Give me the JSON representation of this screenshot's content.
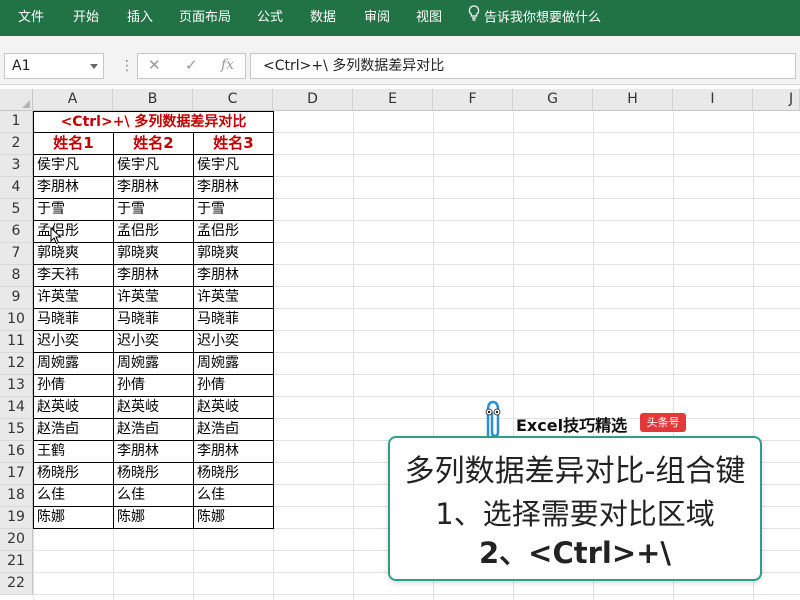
{
  "ribbon": {
    "tabs": [
      "文件",
      "开始",
      "插入",
      "页面布局",
      "公式",
      "数据",
      "审阅",
      "视图"
    ],
    "tell_me": "告诉我你想要做什么",
    "color": "#217346"
  },
  "formula_bar": {
    "name_box": "A1",
    "cancel_icon": "✕",
    "enter_icon": "✓",
    "fx_label": "fx",
    "formula": "<Ctrl>+\\ 多列数据差异对比"
  },
  "columns": [
    "A",
    "B",
    "C",
    "D",
    "E",
    "F",
    "G",
    "H",
    "I",
    "J"
  ],
  "rows": [
    "1",
    "2",
    "3",
    "4",
    "5",
    "6",
    "7",
    "8",
    "9",
    "10",
    "11",
    "12",
    "13",
    "14",
    "15",
    "16",
    "17",
    "18",
    "19",
    "20",
    "21",
    "22"
  ],
  "table": {
    "title": "<Ctrl>+\\ 多列数据差异对比",
    "headers": [
      "姓名1",
      "姓名2",
      "姓名3"
    ],
    "data": [
      [
        "侯宇凡",
        "侯宇凡",
        "侯宇凡"
      ],
      [
        "李朋林",
        "李朋林",
        "李朋林"
      ],
      [
        "于雪",
        "于雪",
        "于雪"
      ],
      [
        "孟侣彤",
        "孟侣彤",
        "孟侣彤"
      ],
      [
        "郭晓爽",
        "郭晓爽",
        "郭晓爽"
      ],
      [
        "李天祎",
        "李朋林",
        "李朋林"
      ],
      [
        "许英莹",
        "许英莹",
        "许英莹"
      ],
      [
        "马晓菲",
        "马晓菲",
        "马晓菲"
      ],
      [
        "迟小奕",
        "迟小奕",
        "迟小奕"
      ],
      [
        "周婉露",
        "周婉露",
        "周婉露"
      ],
      [
        "孙倩",
        "孙倩",
        "孙倩"
      ],
      [
        "赵英岐",
        "赵英岐",
        "赵英岐"
      ],
      [
        "赵浩卣",
        "赵浩卣",
        "赵浩卣"
      ],
      [
        "王鹤",
        "李朋林",
        "李朋林"
      ],
      [
        "杨晓彤",
        "杨晓彤",
        "杨晓彤"
      ],
      [
        "么佳",
        "么佳",
        "么佳"
      ],
      [
        "陈娜",
        "陈娜",
        "陈娜"
      ]
    ],
    "accent_color": "#c00000"
  },
  "overlay": {
    "brand": "Excel技巧精选",
    "brand_tag": "头条号",
    "line1": "多列数据差异对比-组合键",
    "line2": "1、选择需要对比区域",
    "line3": "2、<Ctrl>+\\",
    "border_color": "#2e9e8b"
  }
}
